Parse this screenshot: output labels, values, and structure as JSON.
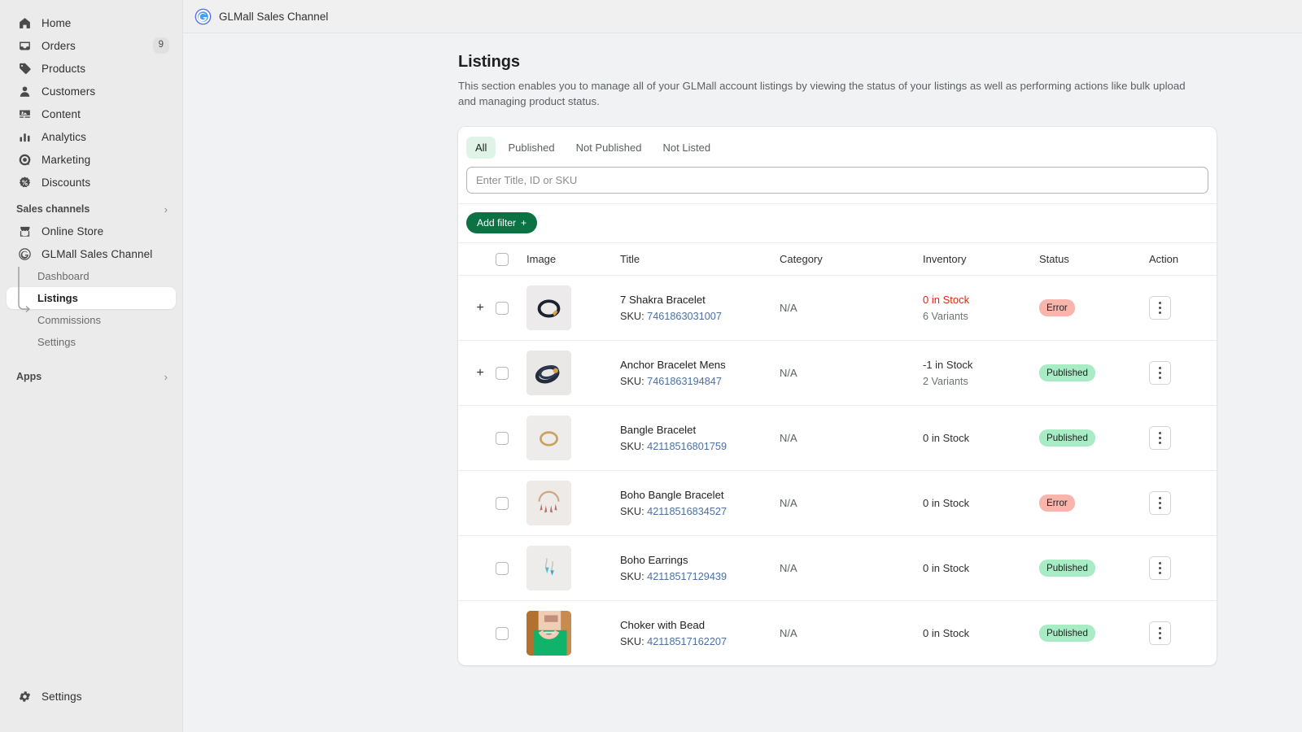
{
  "sidebar": {
    "primary_items": [
      {
        "label": "Home",
        "icon": "home-icon"
      },
      {
        "label": "Orders",
        "icon": "orders-icon",
        "badge": "9"
      },
      {
        "label": "Products",
        "icon": "products-icon"
      },
      {
        "label": "Customers",
        "icon": "customers-icon"
      },
      {
        "label": "Content",
        "icon": "content-icon"
      },
      {
        "label": "Analytics",
        "icon": "analytics-icon"
      },
      {
        "label": "Marketing",
        "icon": "marketing-icon"
      },
      {
        "label": "Discounts",
        "icon": "discounts-icon"
      }
    ],
    "sales_channels_header": "Sales channels",
    "channels": [
      {
        "label": "Online Store",
        "icon": "store-icon"
      },
      {
        "label": "GLMall Sales Channel",
        "icon": "glmall-icon"
      }
    ],
    "channel_subitems": [
      {
        "label": "Dashboard",
        "active": false
      },
      {
        "label": "Listings",
        "active": true
      },
      {
        "label": "Commissions",
        "active": false
      },
      {
        "label": "Settings",
        "active": false
      }
    ],
    "apps_header": "Apps",
    "settings_label": "Settings",
    "settings_icon": "gear-icon"
  },
  "topbar": {
    "app_title": "GLMall Sales Channel",
    "logo_icon": "glmall-logo-icon"
  },
  "page": {
    "title": "Listings",
    "description": "This section enables you to manage all of your GLMall account listings by viewing the status of your listings as well as performing actions like bulk upload and managing product status."
  },
  "filters": {
    "tabs": [
      {
        "label": "All",
        "active": true
      },
      {
        "label": "Published",
        "active": false
      },
      {
        "label": "Not Published",
        "active": false
      },
      {
        "label": "Not Listed",
        "active": false
      }
    ],
    "search_placeholder": "Enter Title, ID or SKU",
    "search_value": "",
    "add_filter_label": "Add filter",
    "add_filter_plus": "+"
  },
  "table": {
    "columns": [
      "Image",
      "Title",
      "Category",
      "Inventory",
      "Status",
      "Action"
    ],
    "sku_prefix": "SKU:",
    "rows": [
      {
        "expandable": true,
        "title": "7 Shakra Bracelet",
        "sku": "7461863031007",
        "category": "N/A",
        "inventory": "0 in Stock",
        "inventory_negative": true,
        "variants": "6 Variants",
        "status": "Error",
        "status_type": "error",
        "thumb": "beaded-bracelet-thumb"
      },
      {
        "expandable": true,
        "title": "Anchor Bracelet Mens",
        "sku": "7461863194847",
        "category": "N/A",
        "inventory": "-1 in Stock",
        "inventory_negative": false,
        "variants": "2 Variants",
        "status": "Published",
        "status_type": "published",
        "thumb": "anchor-bracelet-thumb"
      },
      {
        "expandable": false,
        "title": "Bangle Bracelet",
        "sku": "42118516801759",
        "category": "N/A",
        "inventory": "0 in Stock",
        "inventory_negative": false,
        "variants": "",
        "status": "Published",
        "status_type": "published",
        "thumb": "gold-bangle-thumb"
      },
      {
        "expandable": false,
        "title": "Boho Bangle Bracelet",
        "sku": "42118516834527",
        "category": "N/A",
        "inventory": "0 in Stock",
        "inventory_negative": false,
        "variants": "",
        "status": "Error",
        "status_type": "error",
        "thumb": "boho-bangle-thumb"
      },
      {
        "expandable": false,
        "title": "Boho Earrings",
        "sku": "42118517129439",
        "category": "N/A",
        "inventory": "0 in Stock",
        "inventory_negative": false,
        "variants": "",
        "status": "Published",
        "status_type": "published",
        "thumb": "boho-earrings-thumb"
      },
      {
        "expandable": false,
        "title": "Choker with Bead",
        "sku": "42118517162207",
        "category": "N/A",
        "inventory": "0 in Stock",
        "inventory_negative": false,
        "variants": "",
        "status": "Published",
        "status_type": "published",
        "thumb": "choker-model-thumb"
      }
    ]
  },
  "colors": {
    "accent_green": "#0b7244",
    "tab_active_bg": "#dff3e6",
    "badge_published": "#a8ecc6",
    "badge_error": "#f7b5ab",
    "inventory_alert": "#d82c0d",
    "sidebar_bg": "#ebebeb",
    "page_bg": "#f1f2f4",
    "sku_link": "#4a6fa5"
  }
}
